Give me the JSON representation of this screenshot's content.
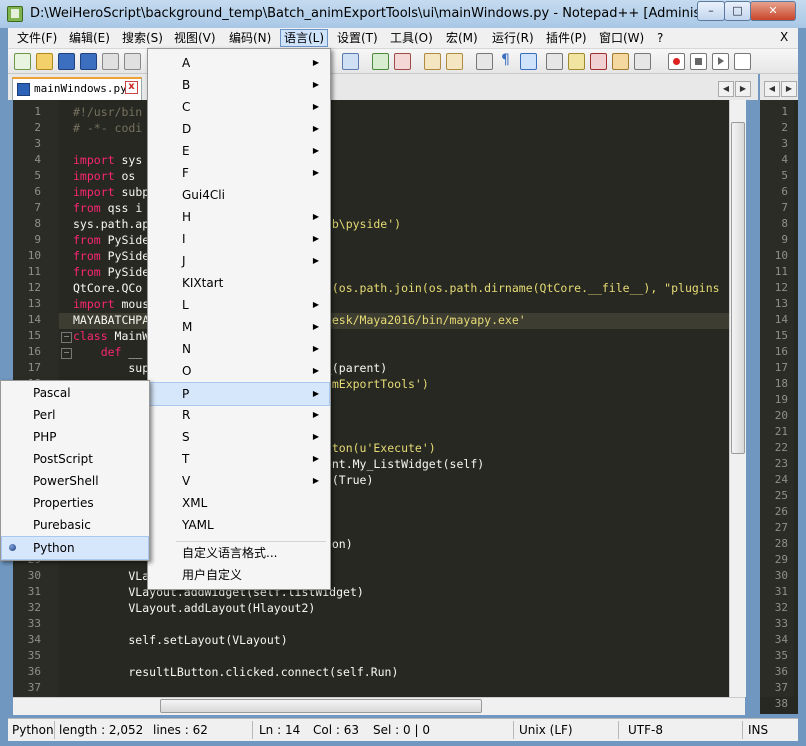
{
  "window": {
    "title": "D:\\WeiHeroScript\\background_temp\\Batch_animExportTools\\ui\\mainWindows.py - Notepad++ [Administrator]",
    "minimize": "–",
    "maximize": "□",
    "close": "✕"
  },
  "menubar": {
    "items": [
      "文件(F)",
      "编辑(E)",
      "搜索(S)",
      "视图(V)",
      "编码(N)",
      "语言(L)",
      "设置(T)",
      "工具(O)",
      "宏(M)",
      "运行(R)",
      "插件(P)",
      "窗口(W)",
      "?"
    ],
    "close": "X"
  },
  "tab": {
    "label": "mainWindows.py",
    "close": "x"
  },
  "editor": {
    "line_numbers": [
      "1",
      "2",
      "3",
      "4",
      "5",
      "6",
      "7",
      "8",
      "9",
      "10",
      "11",
      "12",
      "13",
      "14",
      "15",
      "16",
      "17",
      "18",
      "19",
      "20",
      "21",
      "22",
      "23",
      "24",
      "25",
      "26",
      "27",
      "28",
      "29",
      "30",
      "31",
      "32",
      "33",
      "34",
      "35",
      "36",
      "37"
    ],
    "code_lines": [
      "#!/usr/bin",
      "# -*- codi",
      "",
      "import sys",
      "import os",
      "import subp",
      "from qss i",
      "sys.path.ap",
      "from PySide",
      "from PySide",
      "from PySide",
      "QtCore.QCo",
      "import mous",
      "MAYABATCHPA",
      "class MainW",
      "    def __",
      "        sup",
      "",
      "",
      "",
      "",
      "",
      "",
      "",
      "",
      "",
      "",
      "",
      "",
      "        VLa",
      "        VLayout.addWidget(self.listWidget)",
      "        VLayout.addLayout(Hlayout2)",
      "",
      "        self.setLayout(VLayout)",
      "",
      "        resultLButton.clicked.connect(self.Run)",
      ""
    ],
    "code_right": [
      {
        "line": 8,
        "text": "lib\\pyside')"
      },
      {
        "line": 9,
        "text": "s"
      },
      {
        "line": 12,
        "text": "th(os.path.join(os.path.dirname(QtCore.__file__), \"plugins"
      },
      {
        "line": 14,
        "text": "odesk/Maya2016/bin/mayapy.exe'"
      },
      {
        "line": 17,
        "text": "__(parent)"
      },
      {
        "line": 18,
        "text": "nimExportTools')"
      },
      {
        "line": 22,
        "text": "utton(u'Execute')"
      },
      {
        "line": 23,
        "text": "vent.My_ListWidget(self)"
      },
      {
        "line": 24,
        "text": "ed(True)"
      },
      {
        "line": 26,
        "text": ")"
      },
      {
        "line": 28,
        "text": "tton)"
      }
    ],
    "right_line_numbers": [
      "1",
      "2",
      "3",
      "4",
      "5",
      "6",
      "7",
      "8",
      "9",
      "10",
      "11",
      "12",
      "13",
      "14",
      "15",
      "16",
      "17",
      "18",
      "19",
      "20",
      "21",
      "22",
      "23",
      "24",
      "25",
      "26",
      "27",
      "28",
      "29",
      "30",
      "31",
      "32",
      "33",
      "34",
      "35",
      "36",
      "37",
      "38"
    ]
  },
  "language_menu": {
    "items": [
      "A",
      "B",
      "C",
      "D",
      "E",
      "F",
      "Gui4Cli",
      "H",
      "I",
      "J",
      "KIXtart",
      "L",
      "M",
      "N",
      "O",
      "P",
      "R",
      "S",
      "T",
      "V",
      "XML",
      "YAML"
    ],
    "has_submenu": [
      true,
      true,
      true,
      true,
      true,
      true,
      false,
      true,
      true,
      true,
      false,
      true,
      true,
      true,
      true,
      true,
      true,
      true,
      true,
      true,
      false,
      false
    ],
    "highlighted": "P",
    "define_language": "自定义语言格式...",
    "user_defined": "用户自定义"
  },
  "p_submenu": {
    "items": [
      "Pascal",
      "Perl",
      "PHP",
      "PostScript",
      "PowerShell",
      "Properties",
      "Purebasic",
      "Python"
    ],
    "selected": "Python"
  },
  "statusbar": {
    "language": "Python",
    "length": "length : 2,052",
    "lines": "lines : 62",
    "ln": "Ln : 14",
    "col": "Col : 63",
    "sel": "Sel : 0 | 0",
    "eol": "Unix (LF)",
    "encoding": "UTF-8",
    "mode": "INS"
  },
  "colors": {
    "editor_bg": "#272822",
    "keyword": "#f92672",
    "string": "#e6db74",
    "comment": "#75715e",
    "highlight_line": "#3e3d32",
    "menu_highlight": "#d6e7fb"
  }
}
